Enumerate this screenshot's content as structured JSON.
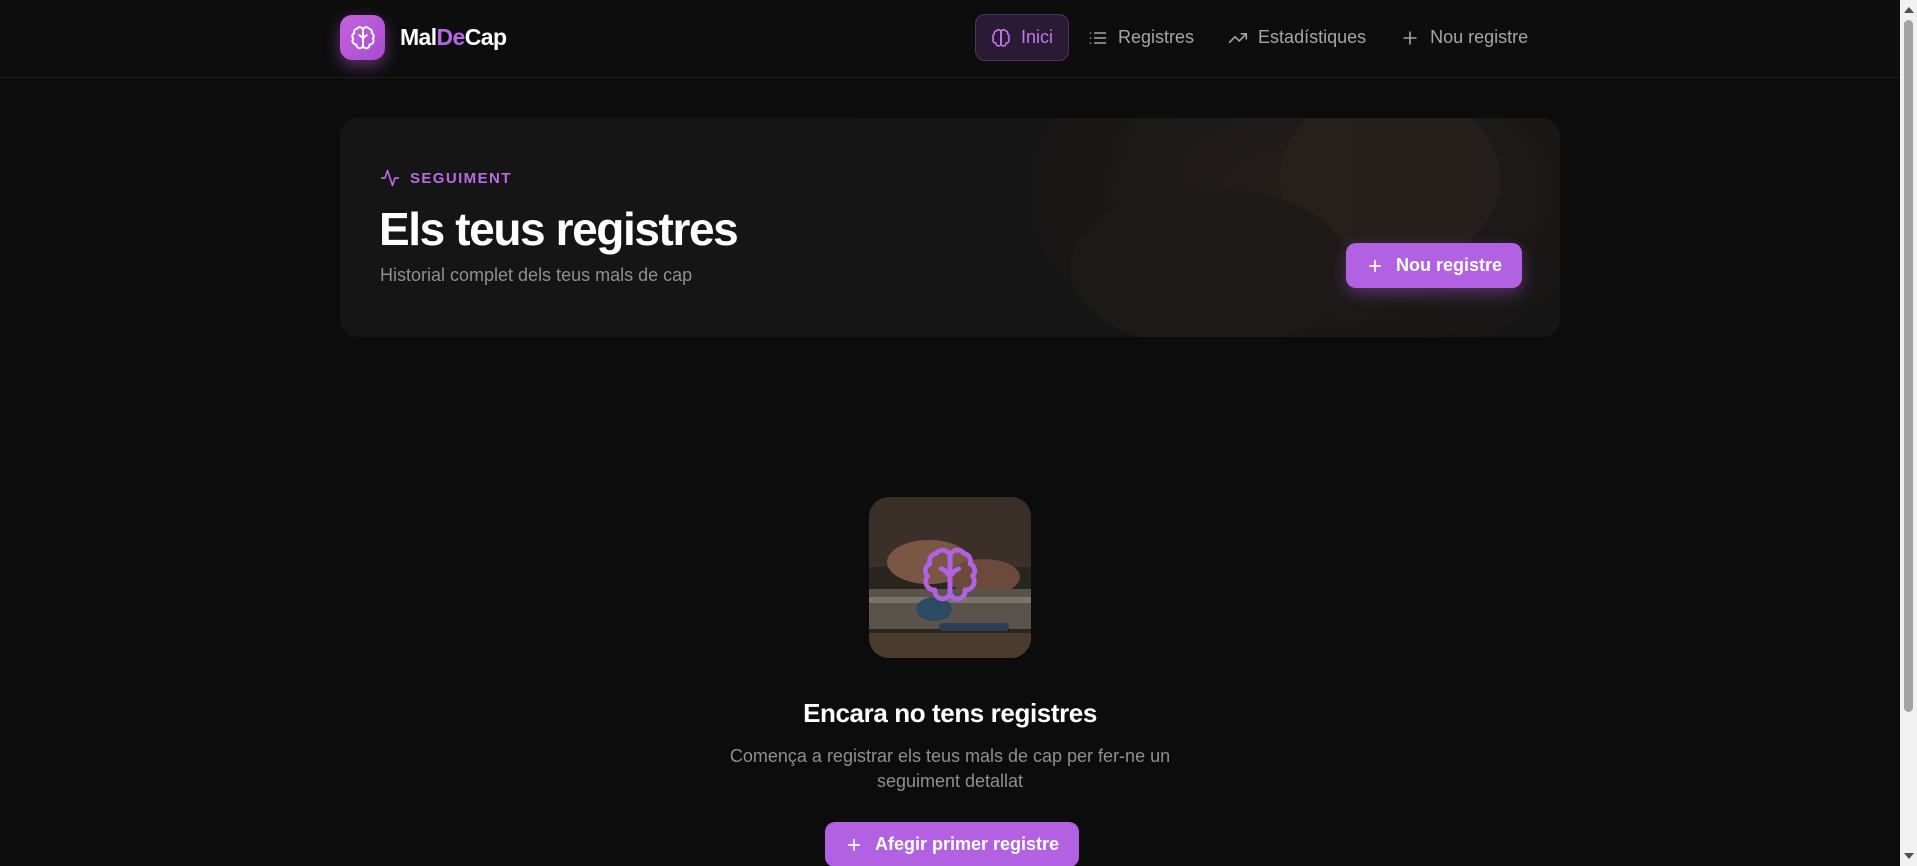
{
  "header": {
    "brand": {
      "part1": "Mal",
      "part2": "De",
      "part3": "Cap"
    },
    "nav": [
      {
        "label": "Inici",
        "icon": "brain-icon",
        "active": true
      },
      {
        "label": "Registres",
        "icon": "list-icon",
        "active": false
      },
      {
        "label": "Estadístiques",
        "icon": "trending-up-icon",
        "active": false
      },
      {
        "label": "Nou registre",
        "icon": "plus-icon",
        "active": false
      }
    ]
  },
  "hero": {
    "eyebrow": "SEGUIMENT",
    "title": "Els teus registres",
    "subtitle": "Historial complet dels teus mals de cap",
    "button_label": "Nou registre"
  },
  "empty_state": {
    "title": "Encara no tens registres",
    "description": "Comença a registrar els teus mals de cap per fer-ne un seguiment detallat",
    "button_label": "Afegir primer registre"
  },
  "colors": {
    "accent": "#b161e2",
    "background": "#0c0c0c",
    "muted_text": "#8f8f8f"
  }
}
